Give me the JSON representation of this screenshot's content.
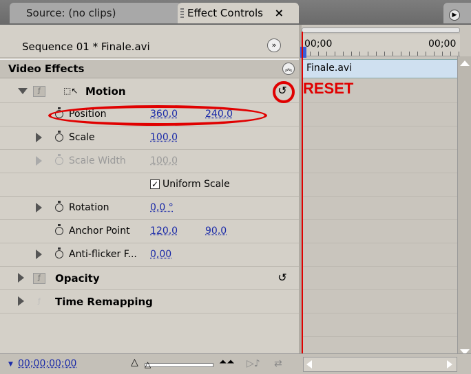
{
  "tabs": {
    "source": "Source: (no clips)",
    "effect_controls": "Effect Controls",
    "close_glyph": "×"
  },
  "header": {
    "sequence": "Sequence 01 * Finale.avi",
    "video_effects": "Video Effects"
  },
  "effects": {
    "motion": {
      "label": "Motion",
      "position": {
        "label": "Position",
        "x": "360,0",
        "y": "240,0"
      },
      "scale": {
        "label": "Scale",
        "value": "100,0"
      },
      "scale_width": {
        "label": "Scale Width",
        "value": "100,0"
      },
      "uniform_scale": {
        "label": "Uniform Scale",
        "checked": true
      },
      "rotation": {
        "label": "Rotation",
        "value": "0,0 °"
      },
      "anchor_point": {
        "label": "Anchor Point",
        "x": "120,0",
        "y": "90,0"
      },
      "anti_flicker": {
        "label": "Anti-flicker F...",
        "value": "0,00"
      }
    },
    "opacity": {
      "label": "Opacity"
    },
    "time_remapping": {
      "label": "Time Remapping"
    }
  },
  "annotation": {
    "reset_text": "RESET",
    "color": "#e00000"
  },
  "timeline": {
    "start": "00;00",
    "end": "00;00",
    "clip": "Finale.avi"
  },
  "footer": {
    "timecode": "00;00;00;00"
  },
  "colors": {
    "panel_bg": "#d4d0c8",
    "link_blue": "#1a2aa8",
    "playhead_red": "#e00000"
  }
}
